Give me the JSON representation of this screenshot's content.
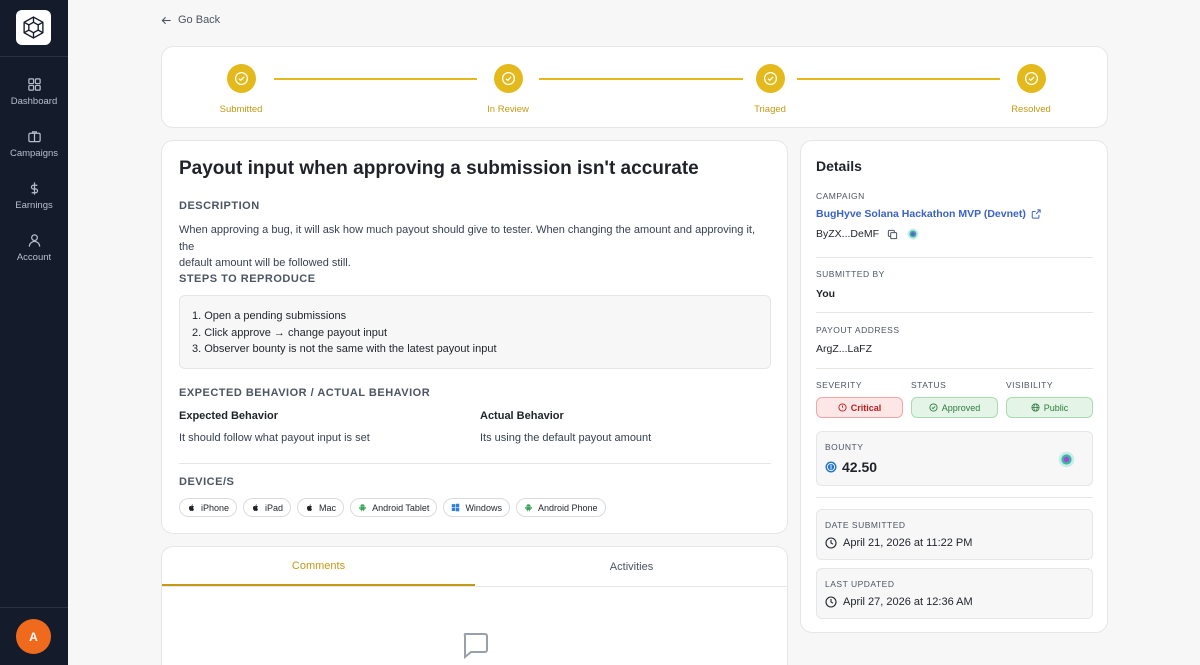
{
  "sidebar": {
    "items": [
      {
        "label": "Dashboard",
        "icon": "grid-icon"
      },
      {
        "label": "Campaigns",
        "icon": "briefcase-icon"
      },
      {
        "label": "Earnings",
        "icon": "dollar-icon"
      },
      {
        "label": "Account",
        "icon": "user-icon"
      }
    ],
    "avatar_initial": "A",
    "avatar_color": "#f06a1d"
  },
  "nav": {
    "go_back": "Go Back"
  },
  "stepper": {
    "steps": [
      "Submitted",
      "In Review",
      "Triaged",
      "Resolved"
    ],
    "accent": "#e3b91c"
  },
  "submission": {
    "title": "Payout input when approving a submission isn't accurate",
    "description_heading": "DESCRIPTION",
    "description_line1": "When approving a bug, it will ask how much payout should give to tester. When changing the amount and approving it, the",
    "description_line2": "default amount will be followed still.",
    "steps_heading": "STEPS TO REPRODUCE",
    "steps": [
      "1. Open a pending submissions",
      "2. Click approve → change payout input",
      "3. Observer bounty is not the same with the latest payout input"
    ],
    "behavior_heading": "EXPECTED BEHAVIOR / ACTUAL BEHAVIOR",
    "expected_label": "Expected Behavior",
    "expected_text": "It should follow what payout input is set",
    "actual_label": "Actual Behavior",
    "actual_text": "Its using the default payout amount",
    "devices_heading": "DEVICE/S",
    "devices": [
      {
        "label": "iPhone",
        "icon": "apple-icon"
      },
      {
        "label": "iPad",
        "icon": "apple-icon"
      },
      {
        "label": "Mac",
        "icon": "apple-icon"
      },
      {
        "label": "Android Tablet",
        "icon": "android-icon"
      },
      {
        "label": "Windows",
        "icon": "windows-icon"
      },
      {
        "label": "Android Phone",
        "icon": "android-icon"
      }
    ]
  },
  "tabs": {
    "comments": "Comments",
    "activities": "Activities",
    "active": "Comments"
  },
  "details": {
    "title": "Details",
    "campaign_label": "CAMPAIGN",
    "campaign_name": "BugHyve Solana Hackathon MVP (Devnet)",
    "campaign_address": "ByZX...DeMF",
    "submitted_by_label": "SUBMITTED BY",
    "submitted_by": "You",
    "payout_address_label": "PAYOUT ADDRESS",
    "payout_address": "ArgZ...LaFZ",
    "severity_label": "SEVERITY",
    "severity": "Critical",
    "status_label": "STATUS",
    "status": "Approved",
    "visibility_label": "VISIBILITY",
    "visibility": "Public",
    "bounty_label": "BOUNTY",
    "bounty": "42.50",
    "date_submitted_label": "DATE SUBMITTED",
    "date_submitted": "April 21, 2026 at 11:22 PM",
    "last_updated_label": "LAST UPDATED",
    "last_updated": "April 27, 2026 at 12:36 AM"
  }
}
